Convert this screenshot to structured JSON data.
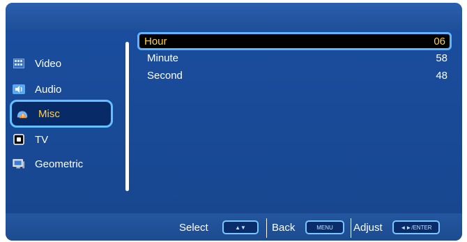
{
  "menu": {
    "items": [
      {
        "label": "Video",
        "icon": "video-icon"
      },
      {
        "label": "Audio",
        "icon": "audio-icon"
      },
      {
        "label": "Misc",
        "icon": "misc-icon",
        "selected": true
      },
      {
        "label": "TV",
        "icon": "tv-icon"
      },
      {
        "label": "Geometric",
        "icon": "geometric-icon"
      }
    ]
  },
  "settings": {
    "rows": [
      {
        "label": "Hour",
        "value": "06",
        "selected": true
      },
      {
        "label": "Minute",
        "value": "58"
      },
      {
        "label": "Second",
        "value": "48"
      }
    ]
  },
  "footer": {
    "select_label": "Select",
    "select_key": "▲▼",
    "back_label": "Back",
    "back_key": "MENU",
    "adjust_label": "Adjust",
    "adjust_key": "◄►/ENTER"
  },
  "colors": {
    "background": "#1c4f9c",
    "selected_text": "#ffd24a",
    "highlight_border": "#64c0ff"
  }
}
